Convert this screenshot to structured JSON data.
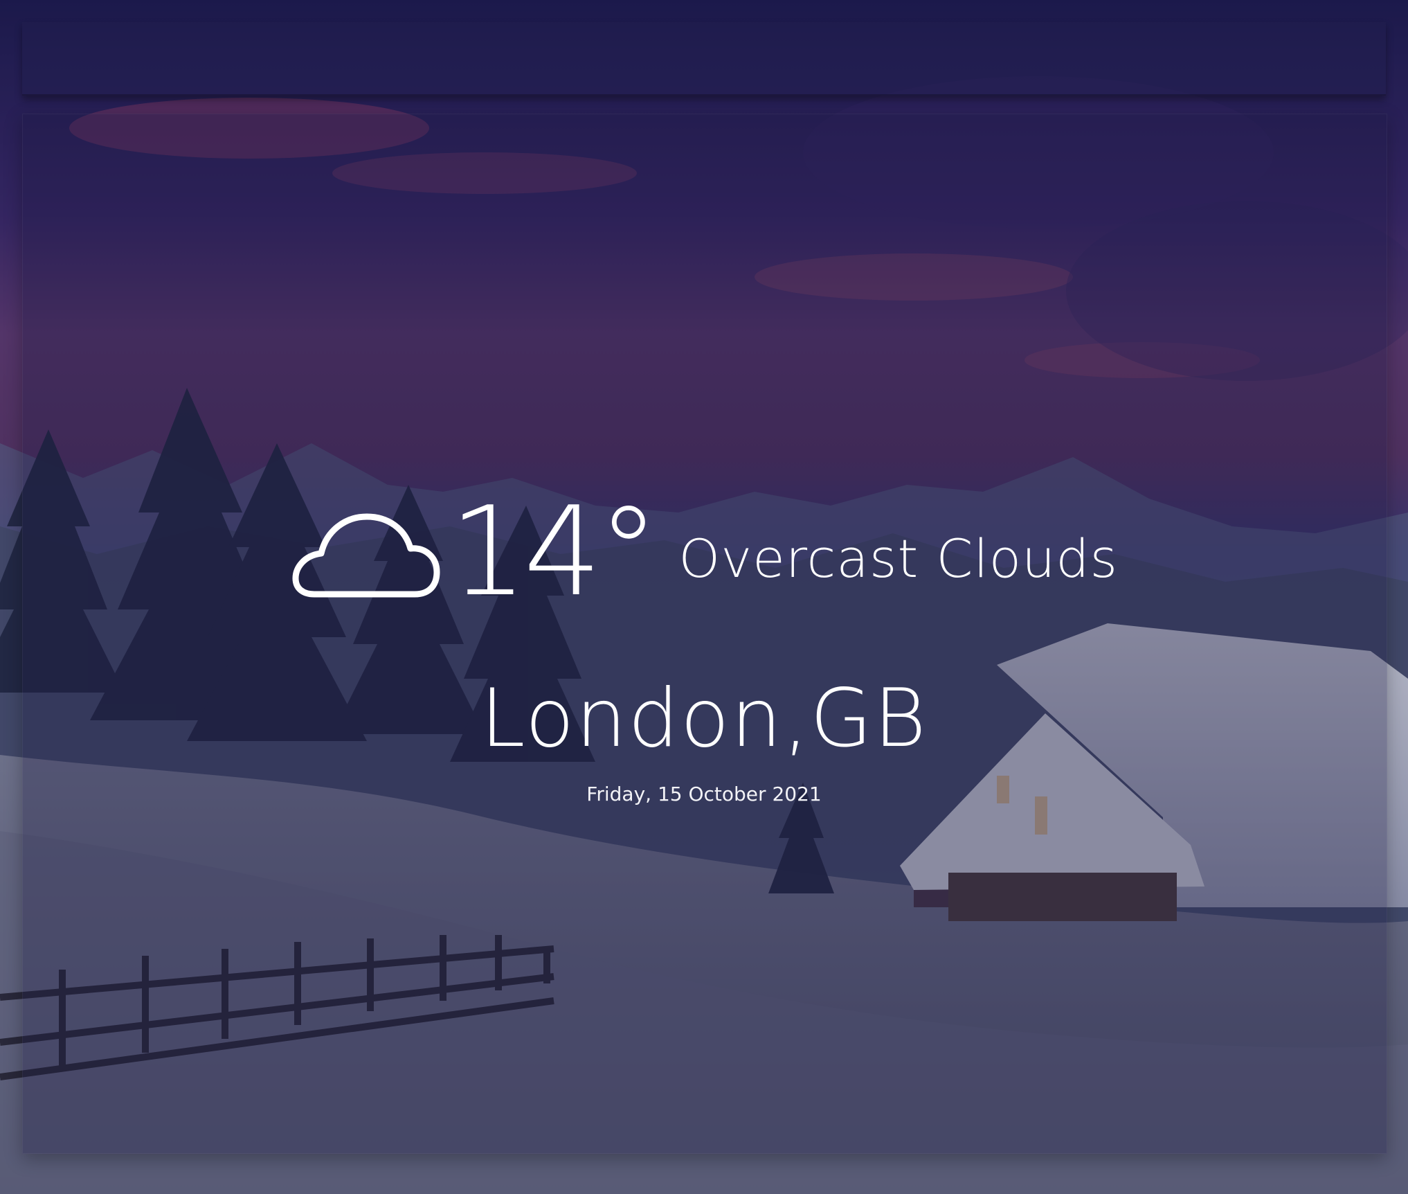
{
  "weather": {
    "icon": "cloud-icon",
    "temperature": "14°",
    "description": "Overcast Clouds",
    "location": "London,GB",
    "date": "Friday, 15 October 2021"
  },
  "theme": {
    "text_color": "#ffffff"
  }
}
